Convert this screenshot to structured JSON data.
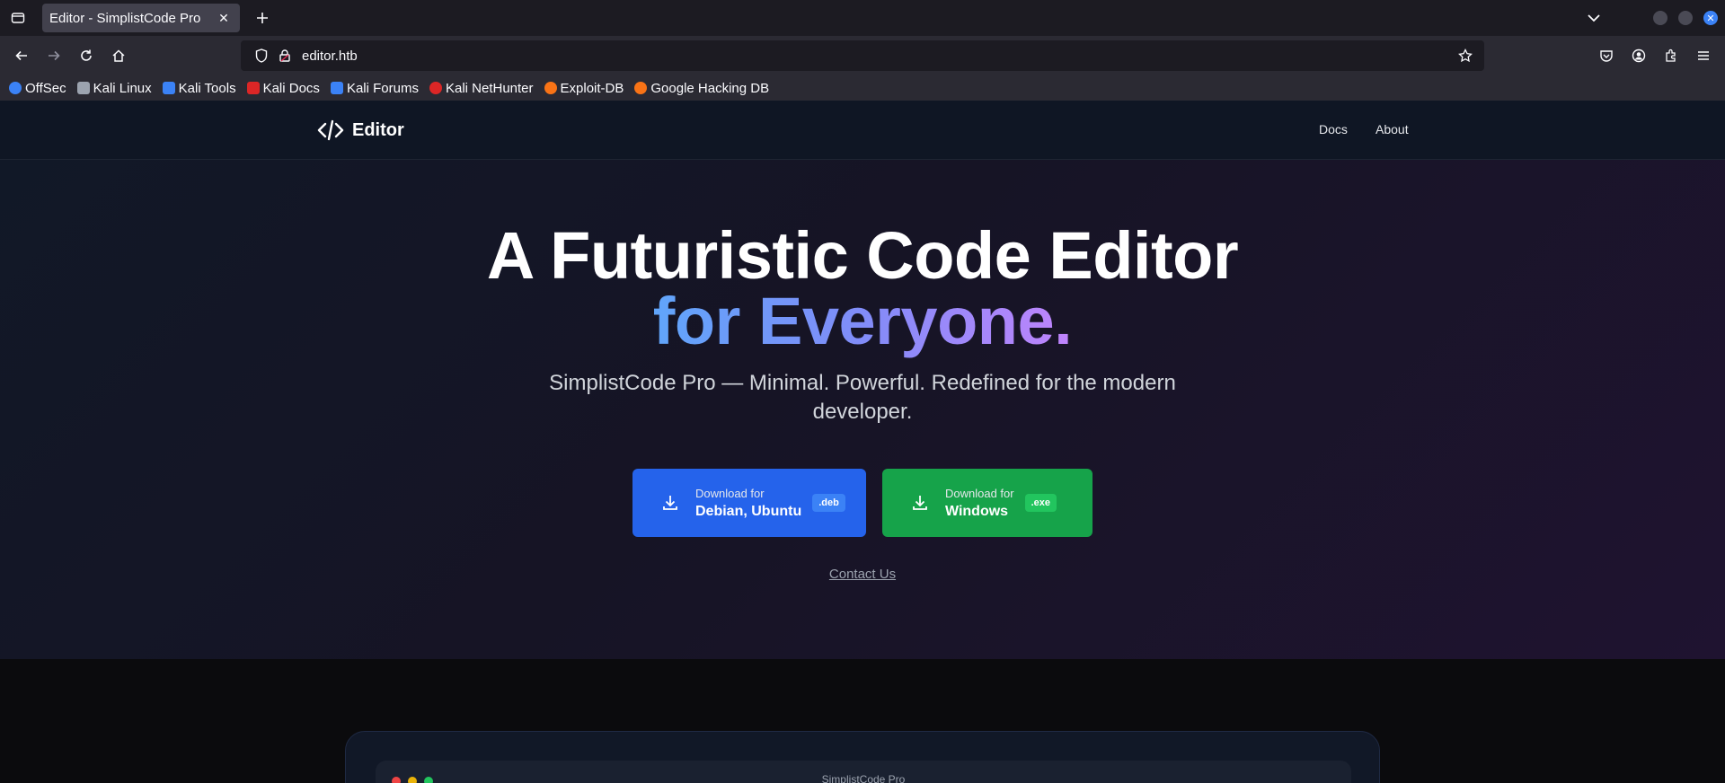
{
  "browser": {
    "tab_title": "Editor - SimplistCode Pro",
    "url": "editor.htb",
    "bookmarks": [
      {
        "label": "OffSec",
        "color": "#3b82f6"
      },
      {
        "label": "Kali Linux",
        "color": "#9ca3af"
      },
      {
        "label": "Kali Tools",
        "color": "#3b82f6"
      },
      {
        "label": "Kali Docs",
        "color": "#dc2626"
      },
      {
        "label": "Kali Forums",
        "color": "#3b82f6"
      },
      {
        "label": "Kali NetHunter",
        "color": "#dc2626"
      },
      {
        "label": "Exploit-DB",
        "color": "#f97316"
      },
      {
        "label": "Google Hacking DB",
        "color": "#f97316"
      }
    ]
  },
  "site": {
    "logo_text": "Editor",
    "nav": {
      "docs": "Docs",
      "about": "About"
    },
    "hero": {
      "line1": "A Futuristic Code Editor",
      "line2": "for Everyone.",
      "subtitle": "SimplistCode Pro — Minimal. Powerful. Redefined for the modern developer."
    },
    "downloads": [
      {
        "small": "Download for",
        "big": "Debian, Ubuntu",
        "badge": ".deb",
        "color": "#2563eb"
      },
      {
        "small": "Download for",
        "big": "Windows",
        "badge": ".exe",
        "color": "#16a34a"
      }
    ],
    "contact_label": "Contact Us",
    "preview_title": "SimplistCode Pro"
  }
}
